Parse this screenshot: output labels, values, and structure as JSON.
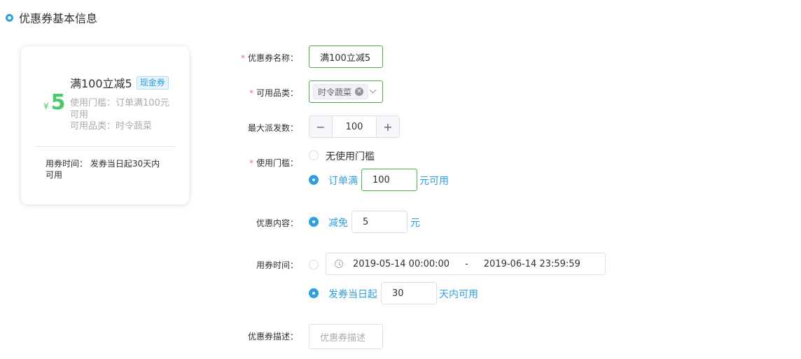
{
  "section": {
    "title": "优惠券基本信息"
  },
  "preview": {
    "currency": "¥",
    "amount": "5",
    "name": "满100立减5",
    "tag": "现金券",
    "threshold": "使用门槛：订单满100元可用",
    "category": "可用品类：时令蔬菜",
    "time": "用券时间： 发券当日起30天内可用"
  },
  "form": {
    "name": {
      "label": "优惠券名称：",
      "value": "满100立减5"
    },
    "category": {
      "label": "可用品类：",
      "selected": "时令蔬菜"
    },
    "max_issue": {
      "label": "最大派发数：",
      "value": "100",
      "minus": "−",
      "plus": "+"
    },
    "threshold": {
      "label": "使用门槛：",
      "option_none": "无使用门槛",
      "option_order_prefix": "订单满",
      "order_amount": "100",
      "option_order_suffix": "元可用"
    },
    "content": {
      "label": "优惠内容：",
      "prefix": "减免",
      "amount": "5",
      "suffix": "元"
    },
    "time": {
      "label": "用券时间：",
      "start": "2019-05-14 00:00:00",
      "separator": "-",
      "end": "2019-06-14 23:59:59",
      "relative_prefix": "发券当日起",
      "days": "30",
      "relative_suffix": "天内可用"
    },
    "description": {
      "label": "优惠券描述：",
      "placeholder": "优惠券描述"
    }
  },
  "colors": {
    "accent": "#2d9fe0",
    "success": "#48b04a",
    "amount": "#4cc86b",
    "required": "#f56c6c"
  }
}
